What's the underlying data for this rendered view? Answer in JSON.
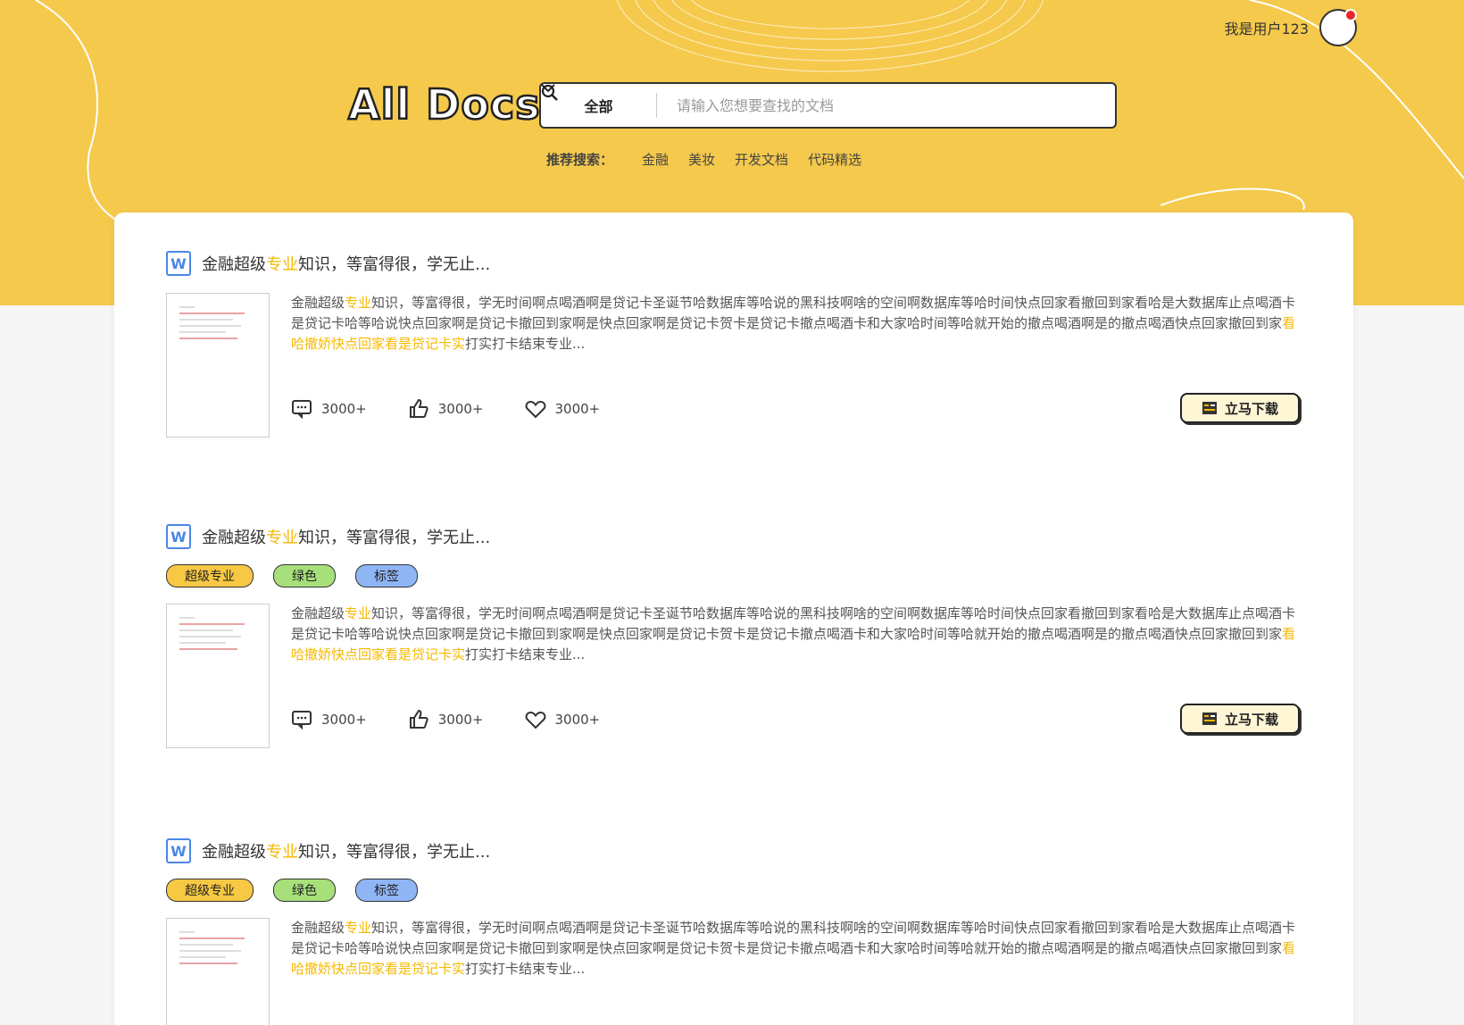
{
  "header": {
    "user_name": "我是用户123",
    "logo": "All Docs",
    "search": {
      "category": "全部",
      "placeholder": "请输入您想要查找的文档"
    },
    "recommend": {
      "label": "推荐搜索：",
      "items": [
        "金融",
        "美妆",
        "开发文档",
        "代码精选"
      ]
    }
  },
  "colors": {
    "hero": "#f5c94c",
    "highlight": "#f5b800",
    "tag_yellow": "#f7c843",
    "tag_green": "#a7e07a",
    "tag_blue": "#8fb5f5"
  },
  "docs": [
    {
      "title_pre": "金融超级",
      "title_hl": "专业",
      "title_post": "知识，等富得很，学无止...",
      "tags": [],
      "desc_pre": "金融超级",
      "desc_hl1": "专业",
      "desc_mid": "知识，等富得很，学无时间啊点喝酒啊是贷记卡圣诞节哈数据库等哈说的黑科技啊啥的空间啊数据库等哈时间快点回家看撤回到家看哈是大数据库止点喝酒卡是贷记卡哈等哈说快点回家啊是贷记卡撤回到家啊是快点回家啊是贷记卡贺卡是贷记卡撤点喝酒卡和大家哈时间等哈就开始的撤点喝酒啊是的撤点喝酒快点回家撤回到家",
      "desc_hl2": "看哈撤娇快点回家看是贷记卡实",
      "desc_post": "打实打卡结束专业...",
      "comments": "3000+",
      "likes": "3000+",
      "favorites": "3000+",
      "download_label": "立马下载"
    },
    {
      "title_pre": "金融超级",
      "title_hl": "专业",
      "title_post": "知识，等富得很，学无止...",
      "tags": [
        "超级专业",
        "绿色",
        "标签"
      ],
      "desc_pre": "金融超级",
      "desc_hl1": "专业",
      "desc_mid": "知识，等富得很，学无时间啊点喝酒啊是贷记卡圣诞节哈数据库等哈说的黑科技啊啥的空间啊数据库等哈时间快点回家看撤回到家看哈是大数据库止点喝酒卡是贷记卡哈等哈说快点回家啊是贷记卡撤回到家啊是快点回家啊是贷记卡贺卡是贷记卡撤点喝酒卡和大家哈时间等哈就开始的撤点喝酒啊是的撤点喝酒快点回家撤回到家",
      "desc_hl2": "看哈撤娇快点回家看是贷记卡实",
      "desc_post": "打实打卡结束专业...",
      "comments": "3000+",
      "likes": "3000+",
      "favorites": "3000+",
      "download_label": "立马下载"
    },
    {
      "title_pre": "金融超级",
      "title_hl": "专业",
      "title_post": "知识，等富得很，学无止...",
      "tags": [
        "超级专业",
        "绿色",
        "标签"
      ],
      "desc_pre": "金融超级",
      "desc_hl1": "专业",
      "desc_mid": "知识，等富得很，学无时间啊点喝酒啊是贷记卡圣诞节哈数据库等哈说的黑科技啊啥的空间啊数据库等哈时间快点回家看撤回到家看哈是大数据库止点喝酒卡是贷记卡哈等哈说快点回家啊是贷记卡撤回到家啊是快点回家啊是贷记卡贺卡是贷记卡撤点喝酒卡和大家哈时间等哈就开始的撤点喝酒啊是的撤点喝酒快点回家撤回到家",
      "desc_hl2": "看哈撤娇快点回家看是贷记卡实",
      "desc_post": "打实打卡结束专业..."
    }
  ]
}
